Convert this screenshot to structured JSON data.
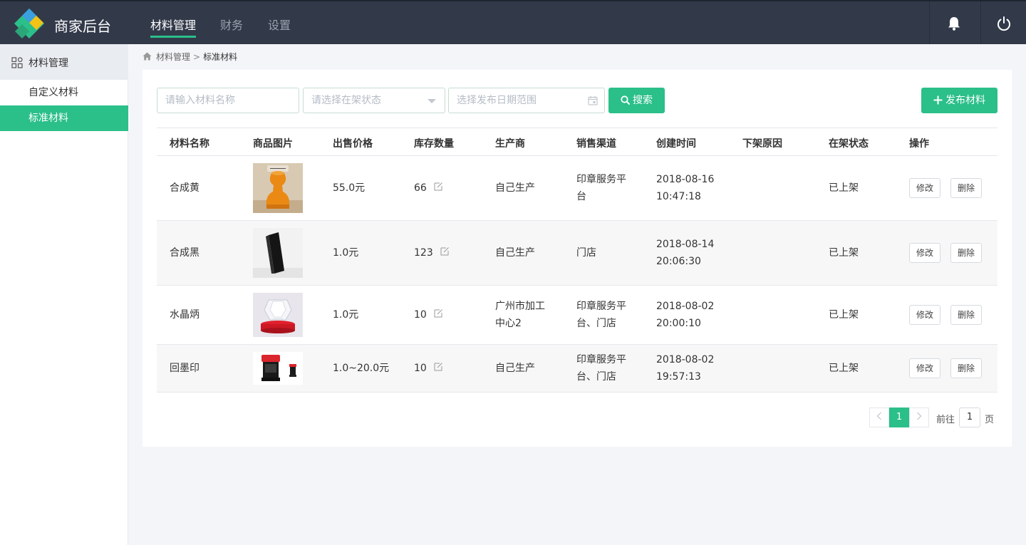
{
  "header": {
    "brand": "商家后台",
    "nav": [
      {
        "label": "材料管理",
        "active": true
      },
      {
        "label": "财务",
        "active": false
      },
      {
        "label": "设置",
        "active": false
      }
    ],
    "icons": [
      "bell-icon",
      "power-icon"
    ],
    "accent_color": "#2bbf8a",
    "bg_color": "#323a4a"
  },
  "sidebar": {
    "section": "材料管理",
    "items": [
      {
        "label": "自定义材料",
        "active": false
      },
      {
        "label": "标准材料",
        "active": true
      }
    ]
  },
  "breadcrumb": {
    "parent": "材料管理",
    "separator": ">",
    "current": "标准材料"
  },
  "filters": {
    "name_placeholder": "请输入材料名称",
    "status_placeholder": "请选择在架状态",
    "date_placeholder": "选择发布日期范围",
    "search_label": "搜索",
    "publish_label": "发布材料"
  },
  "table": {
    "columns": [
      "材料名称",
      "商品图片",
      "出售价格",
      "库存数量",
      "生产商",
      "销售渠道",
      "创建时间",
      "下架原因",
      "在架状态",
      "操作"
    ],
    "rows": [
      {
        "name": "合成黄",
        "image": "orange-stamp-photo",
        "price": "55.0元",
        "stock": "66",
        "maker": [
          "自己生产"
        ],
        "channel": [
          "印章服务平",
          "台"
        ],
        "created": [
          "2018-08-16",
          "10:47:18"
        ],
        "reason": "",
        "status": "已上架",
        "edit": "修改",
        "delete": "删除"
      },
      {
        "name": "合成黑",
        "image": "black-stamp-photo",
        "price": "1.0元",
        "stock": "123",
        "maker": [
          "自己生产"
        ],
        "channel": [
          "门店"
        ],
        "created": [
          "2018-08-14",
          "20:06:30"
        ],
        "reason": "",
        "status": "已上架",
        "edit": "修改",
        "delete": "删除"
      },
      {
        "name": "水晶炳",
        "image": "crystal-stamp-photo",
        "price": "1.0元",
        "stock": "10",
        "maker": [
          "广州市加工",
          "中心2"
        ],
        "channel": [
          "印章服务平",
          "台、门店"
        ],
        "created": [
          "2018-08-02",
          "20:00:10"
        ],
        "reason": "",
        "status": "已上架",
        "edit": "修改",
        "delete": "删除"
      },
      {
        "name": "回墨印",
        "image": "self-inking-stamp-photo",
        "price": "1.0~20.0元",
        "stock": "10",
        "maker": [
          "自己生产"
        ],
        "channel": [
          "印章服务平",
          "台、门店"
        ],
        "created": [
          "2018-08-02",
          "19:57:13"
        ],
        "reason": "",
        "status": "已上架",
        "edit": "修改",
        "delete": "删除"
      }
    ]
  },
  "pagination": {
    "current": "1",
    "goto_label": "前往",
    "goto_value": "1",
    "page_suffix": "页"
  }
}
